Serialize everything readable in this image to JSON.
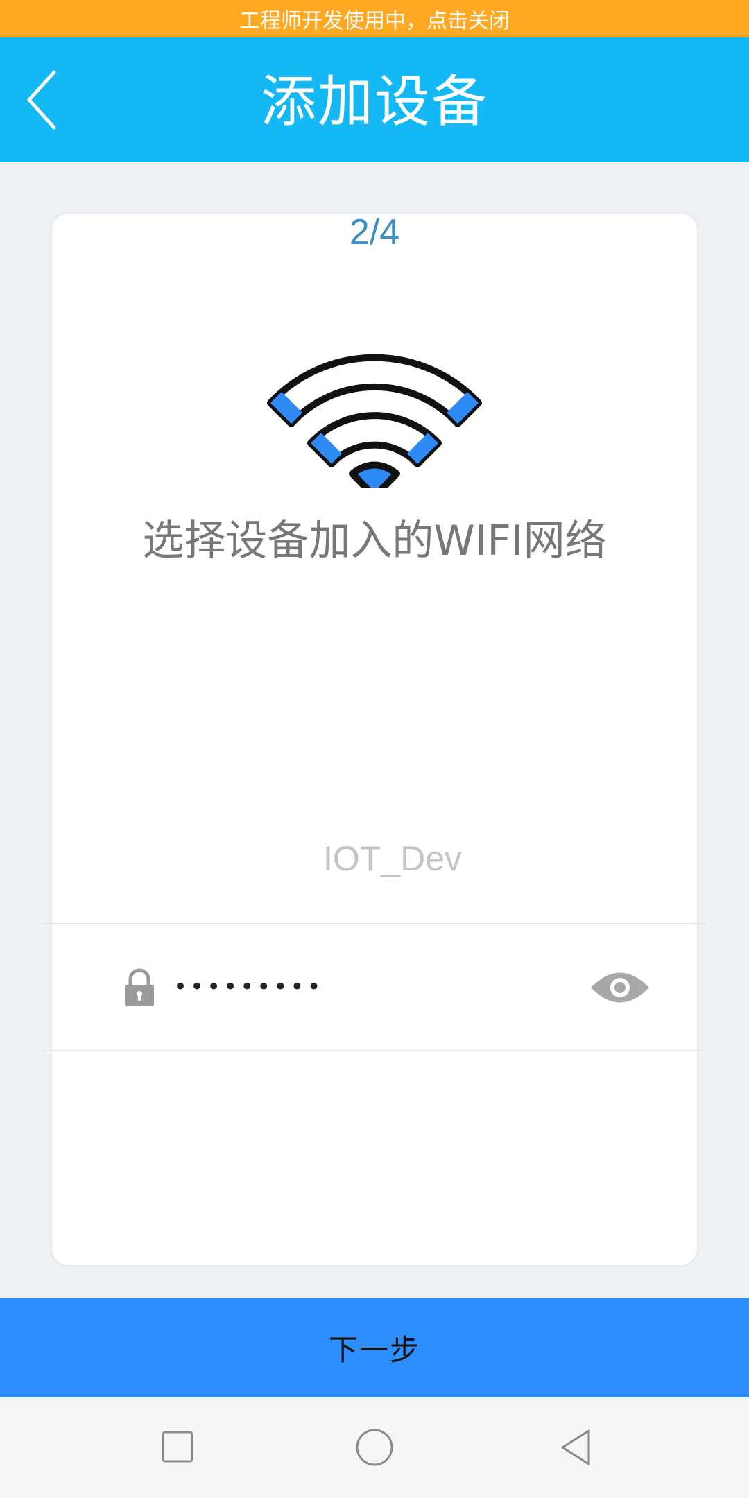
{
  "dev_banner": {
    "text": "工程师开发使用中，点击关闭",
    "color": "#ffa923"
  },
  "header": {
    "title": "添加设备",
    "back_icon": "chevron-left-icon",
    "background": "#14b8f5"
  },
  "card": {
    "step": "2/4",
    "illustration_icon": "wifi-icon",
    "instruction": "选择设备加入的WIFI网络",
    "ssid": "IOT_Dev",
    "password_field": {
      "value": "password1",
      "lock_icon": "lock-icon",
      "visibility_icon": "eye-icon"
    }
  },
  "next_button": {
    "label": "下一步",
    "color": "#2c8eff"
  },
  "nav_bar": {
    "buttons": [
      "recents-square-icon",
      "home-circle-icon",
      "back-triangle-icon"
    ]
  }
}
